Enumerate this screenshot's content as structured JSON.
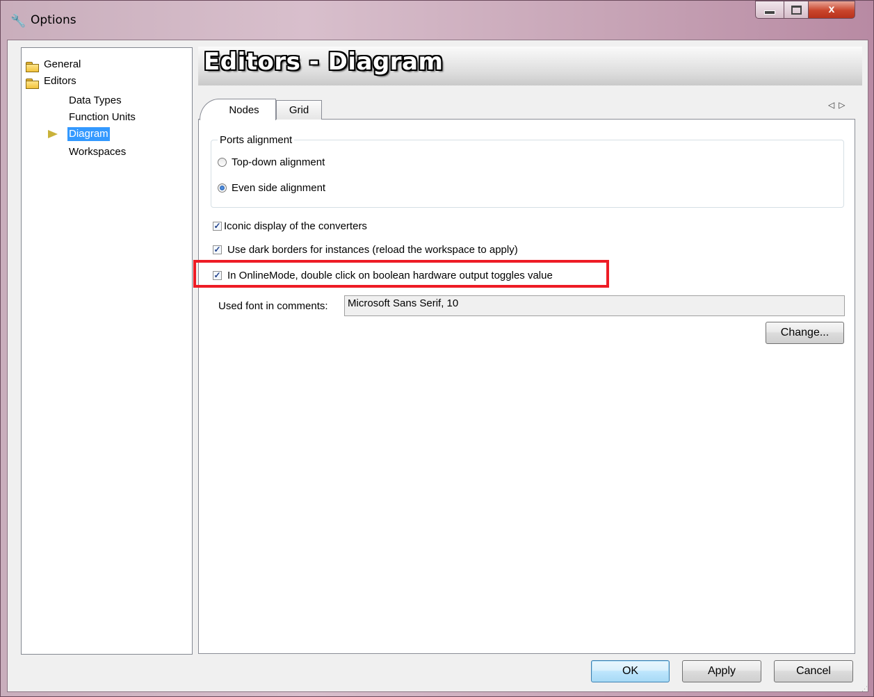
{
  "window": {
    "title": "Options",
    "controls": {
      "minimize": "",
      "maximize": "",
      "close": "x"
    }
  },
  "tree": {
    "items": [
      {
        "label": "General",
        "type": "folder"
      },
      {
        "label": "Editors",
        "type": "folder-open"
      },
      {
        "label": "Data Types",
        "type": "leaf"
      },
      {
        "label": "Function Units",
        "type": "leaf"
      },
      {
        "label": "Diagram",
        "type": "leaf",
        "selected": true
      },
      {
        "label": "Workspaces",
        "type": "leaf"
      }
    ]
  },
  "header": {
    "title": "Editors - Diagram"
  },
  "tabs": [
    {
      "label": "Nodes",
      "active": true
    },
    {
      "label": "Grid",
      "active": false
    }
  ],
  "ports_alignment": {
    "group_label": "Ports alignment",
    "options": [
      {
        "label": "Top-down alignment",
        "selected": false
      },
      {
        "label": "Even side alignment",
        "selected": true
      }
    ]
  },
  "checkboxes": [
    {
      "label": "Iconic display of the converters",
      "checked": true
    },
    {
      "label": "Use dark borders for instances (reload the workspace to apply)",
      "checked": true
    },
    {
      "label": "In OnlineMode, double click on boolean hardware output toggles value",
      "checked": true
    }
  ],
  "font": {
    "label": "Used font in comments:",
    "value": "Microsoft Sans Serif, 10",
    "change_label": "Change..."
  },
  "buttons": {
    "ok": "OK",
    "apply": "Apply",
    "cancel": "Cancel"
  },
  "colors": {
    "highlight": "#ee1c25",
    "selection": "#3399ff"
  }
}
